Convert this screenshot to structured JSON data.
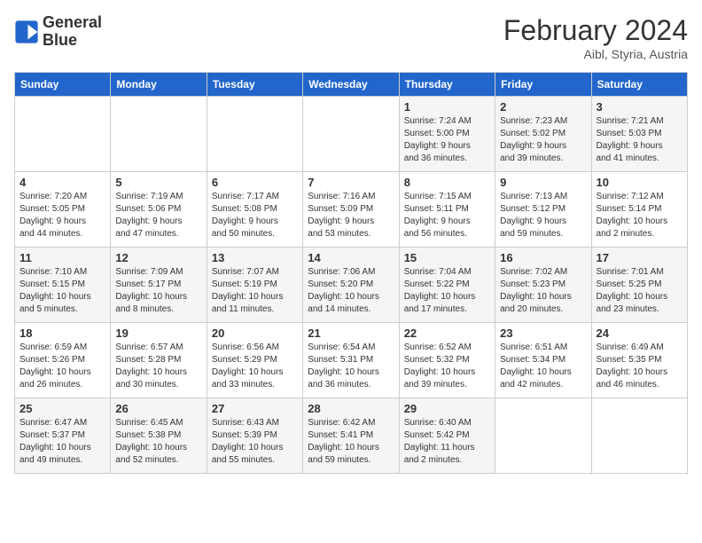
{
  "header": {
    "logo_line1": "General",
    "logo_line2": "Blue",
    "month": "February 2024",
    "location": "Aibl, Styria, Austria"
  },
  "days_of_week": [
    "Sunday",
    "Monday",
    "Tuesday",
    "Wednesday",
    "Thursday",
    "Friday",
    "Saturday"
  ],
  "weeks": [
    [
      {
        "day": "",
        "info": ""
      },
      {
        "day": "",
        "info": ""
      },
      {
        "day": "",
        "info": ""
      },
      {
        "day": "",
        "info": ""
      },
      {
        "day": "1",
        "info": "Sunrise: 7:24 AM\nSunset: 5:00 PM\nDaylight: 9 hours\nand 36 minutes."
      },
      {
        "day": "2",
        "info": "Sunrise: 7:23 AM\nSunset: 5:02 PM\nDaylight: 9 hours\nand 39 minutes."
      },
      {
        "day": "3",
        "info": "Sunrise: 7:21 AM\nSunset: 5:03 PM\nDaylight: 9 hours\nand 41 minutes."
      }
    ],
    [
      {
        "day": "4",
        "info": "Sunrise: 7:20 AM\nSunset: 5:05 PM\nDaylight: 9 hours\nand 44 minutes."
      },
      {
        "day": "5",
        "info": "Sunrise: 7:19 AM\nSunset: 5:06 PM\nDaylight: 9 hours\nand 47 minutes."
      },
      {
        "day": "6",
        "info": "Sunrise: 7:17 AM\nSunset: 5:08 PM\nDaylight: 9 hours\nand 50 minutes."
      },
      {
        "day": "7",
        "info": "Sunrise: 7:16 AM\nSunset: 5:09 PM\nDaylight: 9 hours\nand 53 minutes."
      },
      {
        "day": "8",
        "info": "Sunrise: 7:15 AM\nSunset: 5:11 PM\nDaylight: 9 hours\nand 56 minutes."
      },
      {
        "day": "9",
        "info": "Sunrise: 7:13 AM\nSunset: 5:12 PM\nDaylight: 9 hours\nand 59 minutes."
      },
      {
        "day": "10",
        "info": "Sunrise: 7:12 AM\nSunset: 5:14 PM\nDaylight: 10 hours\nand 2 minutes."
      }
    ],
    [
      {
        "day": "11",
        "info": "Sunrise: 7:10 AM\nSunset: 5:15 PM\nDaylight: 10 hours\nand 5 minutes."
      },
      {
        "day": "12",
        "info": "Sunrise: 7:09 AM\nSunset: 5:17 PM\nDaylight: 10 hours\nand 8 minutes."
      },
      {
        "day": "13",
        "info": "Sunrise: 7:07 AM\nSunset: 5:19 PM\nDaylight: 10 hours\nand 11 minutes."
      },
      {
        "day": "14",
        "info": "Sunrise: 7:06 AM\nSunset: 5:20 PM\nDaylight: 10 hours\nand 14 minutes."
      },
      {
        "day": "15",
        "info": "Sunrise: 7:04 AM\nSunset: 5:22 PM\nDaylight: 10 hours\nand 17 minutes."
      },
      {
        "day": "16",
        "info": "Sunrise: 7:02 AM\nSunset: 5:23 PM\nDaylight: 10 hours\nand 20 minutes."
      },
      {
        "day": "17",
        "info": "Sunrise: 7:01 AM\nSunset: 5:25 PM\nDaylight: 10 hours\nand 23 minutes."
      }
    ],
    [
      {
        "day": "18",
        "info": "Sunrise: 6:59 AM\nSunset: 5:26 PM\nDaylight: 10 hours\nand 26 minutes."
      },
      {
        "day": "19",
        "info": "Sunrise: 6:57 AM\nSunset: 5:28 PM\nDaylight: 10 hours\nand 30 minutes."
      },
      {
        "day": "20",
        "info": "Sunrise: 6:56 AM\nSunset: 5:29 PM\nDaylight: 10 hours\nand 33 minutes."
      },
      {
        "day": "21",
        "info": "Sunrise: 6:54 AM\nSunset: 5:31 PM\nDaylight: 10 hours\nand 36 minutes."
      },
      {
        "day": "22",
        "info": "Sunrise: 6:52 AM\nSunset: 5:32 PM\nDaylight: 10 hours\nand 39 minutes."
      },
      {
        "day": "23",
        "info": "Sunrise: 6:51 AM\nSunset: 5:34 PM\nDaylight: 10 hours\nand 42 minutes."
      },
      {
        "day": "24",
        "info": "Sunrise: 6:49 AM\nSunset: 5:35 PM\nDaylight: 10 hours\nand 46 minutes."
      }
    ],
    [
      {
        "day": "25",
        "info": "Sunrise: 6:47 AM\nSunset: 5:37 PM\nDaylight: 10 hours\nand 49 minutes."
      },
      {
        "day": "26",
        "info": "Sunrise: 6:45 AM\nSunset: 5:38 PM\nDaylight: 10 hours\nand 52 minutes."
      },
      {
        "day": "27",
        "info": "Sunrise: 6:43 AM\nSunset: 5:39 PM\nDaylight: 10 hours\nand 55 minutes."
      },
      {
        "day": "28",
        "info": "Sunrise: 6:42 AM\nSunset: 5:41 PM\nDaylight: 10 hours\nand 59 minutes."
      },
      {
        "day": "29",
        "info": "Sunrise: 6:40 AM\nSunset: 5:42 PM\nDaylight: 11 hours\nand 2 minutes."
      },
      {
        "day": "",
        "info": ""
      },
      {
        "day": "",
        "info": ""
      }
    ]
  ]
}
